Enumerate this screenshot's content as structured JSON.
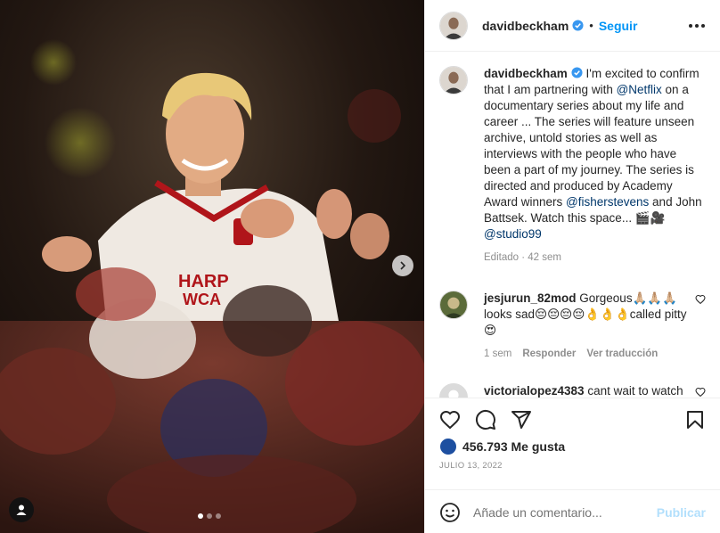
{
  "post": {
    "username": "davidbeckham",
    "follow_label": "Seguir",
    "dot_separator": "•"
  },
  "caption": {
    "username": "davidbeckham",
    "text_before": " I'm excited to confirm that I am partnering with ",
    "mention_netflix": "@Netflix",
    "text_middle": " on a documentary series about my life and career ... The series will feature unseen archive, untold stories as well as interviews with the people who have been a part of my journey. The series is directed and produced by Academy Award winners ",
    "mention_fisher": "@fisherstevens",
    "text_after": " and John Battsek. Watch this space... 🎬🎥 ",
    "mention_studio": "@studio99",
    "edited": "Editado",
    "time": "42 sem"
  },
  "comments": [
    {
      "username": "jesjurun_82mod",
      "text": " Gorgeous🙏🏼🙏🏼🙏🏼 looks sad😔😔😔😔👌👌👌called pitty😍",
      "time": "1 sem",
      "reply": "Responder",
      "translate": "Ver traducción"
    },
    {
      "username": "victorialopez4383",
      "text": " cant wait to watch this David well done!"
    }
  ],
  "likes": {
    "count_text": "456.793 Me gusta"
  },
  "date_text": "JULIO 13, 2022",
  "add_comment": {
    "placeholder": "Añade un comentario...",
    "publish": "Publicar"
  },
  "carousel": {
    "slides": 3,
    "active_index": 0
  },
  "colors": {
    "accent": "#0095f6",
    "verified": "#3897f0",
    "mention": "#00376b",
    "muted": "#8e8e8e"
  },
  "icons": {
    "more": "ellipsis-icon",
    "next": "chevron-right-icon",
    "tag": "user-tag-icon",
    "like": "heart-icon",
    "comment": "comment-icon",
    "share": "paper-plane-icon",
    "save": "bookmark-icon",
    "emoji": "smiley-icon"
  }
}
